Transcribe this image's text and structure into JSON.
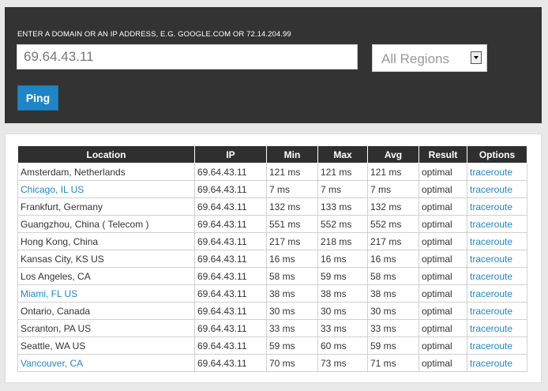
{
  "search": {
    "prompt": "ENTER A DOMAIN OR AN IP ADDRESS, E.G. GOOGLE.COM OR 72.14.204.99",
    "value": "69.64.43.11",
    "region": "All Regions",
    "button_label": "Ping"
  },
  "table": {
    "headers": [
      "Location",
      "IP",
      "Min",
      "Max",
      "Avg",
      "Result",
      "Options"
    ],
    "rows": [
      {
        "location": "Amsterdam, Netherlands",
        "location_link": false,
        "ip": "69.64.43.11",
        "min": "121 ms",
        "max": "121 ms",
        "avg": "121 ms",
        "result": "optimal",
        "option": "traceroute"
      },
      {
        "location": "Chicago, IL US",
        "location_link": true,
        "ip": "69.64.43.11",
        "min": "7 ms",
        "max": "7 ms",
        "avg": "7 ms",
        "result": "optimal",
        "option": "traceroute"
      },
      {
        "location": "Frankfurt, Germany",
        "location_link": false,
        "ip": "69.64.43.11",
        "min": "132 ms",
        "max": "133 ms",
        "avg": "132 ms",
        "result": "optimal",
        "option": "traceroute"
      },
      {
        "location": "Guangzhou, China ( Telecom )",
        "location_link": false,
        "ip": "69.64.43.11",
        "min": "551 ms",
        "max": "552 ms",
        "avg": "552 ms",
        "result": "optimal",
        "option": "traceroute"
      },
      {
        "location": "Hong Kong, China",
        "location_link": false,
        "ip": "69.64.43.11",
        "min": "217 ms",
        "max": "218 ms",
        "avg": "217 ms",
        "result": "optimal",
        "option": "traceroute"
      },
      {
        "location": "Kansas City, KS US",
        "location_link": false,
        "ip": "69.64.43.11",
        "min": "16 ms",
        "max": "16 ms",
        "avg": "16 ms",
        "result": "optimal",
        "option": "traceroute"
      },
      {
        "location": "Los Angeles, CA",
        "location_link": false,
        "ip": "69.64.43.11",
        "min": "58 ms",
        "max": "59 ms",
        "avg": "58 ms",
        "result": "optimal",
        "option": "traceroute"
      },
      {
        "location": "Miami, FL US",
        "location_link": true,
        "ip": "69.64.43.11",
        "min": "38 ms",
        "max": "38 ms",
        "avg": "38 ms",
        "result": "optimal",
        "option": "traceroute"
      },
      {
        "location": "Ontario, Canada",
        "location_link": false,
        "ip": "69.64.43.11",
        "min": "30 ms",
        "max": "30 ms",
        "avg": "30 ms",
        "result": "optimal",
        "option": "traceroute"
      },
      {
        "location": "Scranton, PA US",
        "location_link": false,
        "ip": "69.64.43.11",
        "min": "33 ms",
        "max": "33 ms",
        "avg": "33 ms",
        "result": "optimal",
        "option": "traceroute"
      },
      {
        "location": "Seattle, WA US",
        "location_link": false,
        "ip": "69.64.43.11",
        "min": "59 ms",
        "max": "60 ms",
        "avg": "59 ms",
        "result": "optimal",
        "option": "traceroute"
      },
      {
        "location": "Vancouver, CA",
        "location_link": true,
        "ip": "69.64.43.11",
        "min": "70 ms",
        "max": "73 ms",
        "avg": "71 ms",
        "result": "optimal",
        "option": "traceroute"
      }
    ]
  },
  "colors": {
    "panel_dark": "#333333",
    "header_dark": "#2f2f2f",
    "accent_blue": "#1e86c6"
  },
  "icons": {
    "dropdown": "chevron-down-icon"
  }
}
